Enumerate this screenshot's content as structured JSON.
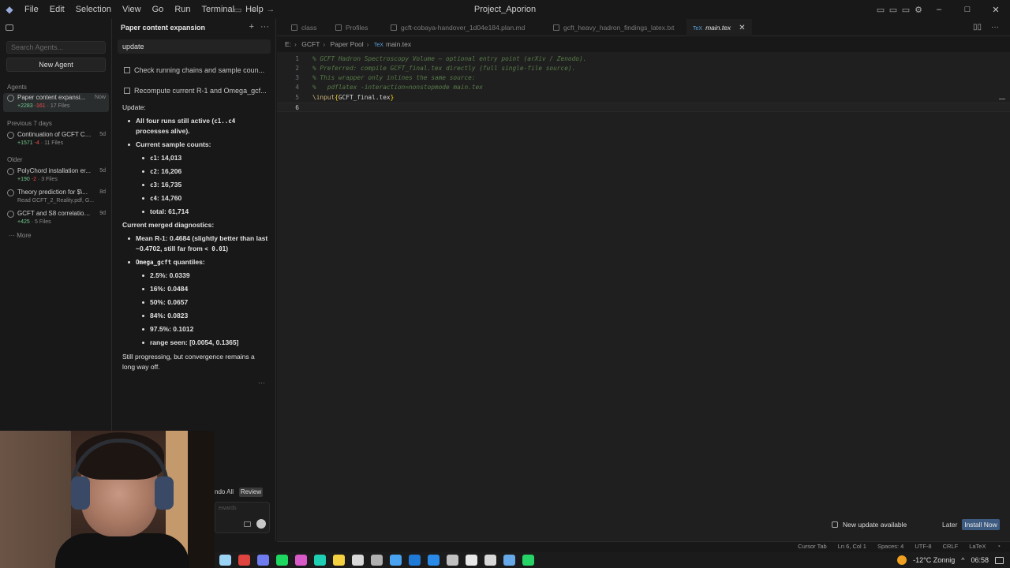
{
  "window": {
    "title": "Project_Aporion",
    "menu": [
      "File",
      "Edit",
      "Selection",
      "View",
      "Go",
      "Run",
      "Terminal",
      "Help"
    ]
  },
  "agents_panel": {
    "search_placeholder": "Search Agents...",
    "new_agent_label": "New Agent",
    "section_agents": "Agents",
    "section_prev7": "Previous 7 days",
    "section_older": "Older",
    "more_label": "More",
    "items": [
      {
        "name": "Paper content expansi...",
        "time": "Now",
        "plus": "+2283",
        "minus": "-161",
        "files": "· 17 Files",
        "active": true
      },
      {
        "name": "Continuation of GCFT Co...",
        "time": "5d",
        "plus": "+1571",
        "minus": "-4",
        "files": "· 11 Files"
      },
      {
        "name": "PolyChord installation er...",
        "time": "5d",
        "plus": "+190",
        "minus": "-2",
        "files": "· 3 Files"
      },
      {
        "name": "Theory prediction for $\\...",
        "time": "8d",
        "sub": "Read GCFT_2_Reality.pdf, G..."
      },
      {
        "name": "GCFT and S8 correlation ...",
        "time": "9d",
        "plus": "+425",
        "minus": "",
        "files": "· 5 Files"
      }
    ]
  },
  "chat": {
    "header": "Paper content expansion",
    "input_text": "update",
    "todos": [
      "Check running chains and sample coun...",
      "Recompute current R-1 and Omega_gcf..."
    ],
    "update_heading": "Update:",
    "runs_line_a": "All four runs still active (",
    "runs_code": "c1..c4",
    "runs_line_b": "processes alive).",
    "counts_heading": "Current sample counts:",
    "counts": [
      {
        "code": "c1",
        "value": ": 14,013"
      },
      {
        "code": "c2",
        "value": ": 16,206"
      },
      {
        "code": "c3",
        "value": ": 16,735"
      },
      {
        "code": "c4",
        "value": ": 14,760"
      }
    ],
    "total": "total: 61,714",
    "diag_heading": "Current merged diagnostics:",
    "mean_a": "Mean R-1: 0.4684",
    "mean_b": "(slightly better than last",
    "mean_c": "~0.4702, still far from",
    "mean_code": "< 0.01",
    "mean_d": ")",
    "omega_code": "Omega_gcft",
    "omega_label": "quantiles:",
    "quantiles": [
      "2.5%: 0.0339",
      "16%: 0.0484",
      "50%: 0.0657",
      "84%: 0.0823",
      "97.5%: 0.1012",
      "range seen: [0.0054, 0.1365]"
    ],
    "closing_a": "Still progressing, but convergence remains a",
    "closing_b": "long way off.",
    "undo_all": "ndo All",
    "review": "Review",
    "compose_placeholder": "ewards"
  },
  "editor": {
    "tabs": [
      {
        "label": "class"
      },
      {
        "label": "Profiles"
      },
      {
        "label": "gcft-cobaya-handover_1d04e184.plan.md"
      },
      {
        "label": "gcft_heavy_hadron_findings_latex.txt"
      },
      {
        "label": "main.tex",
        "active": true
      }
    ],
    "breadcrumb": [
      "E:",
      "GCFT",
      "Paper Pool",
      "main.tex"
    ],
    "lines": [
      {
        "n": "1",
        "text": "% GCFT Hadron Spectroscopy Volume — optional entry point (arXiv / Zenodo)."
      },
      {
        "n": "2",
        "text": "% Preferred: compile GCFT_final.tex directly (full single-file source)."
      },
      {
        "n": "3",
        "text": "% This wrapper only inlines the same source:"
      },
      {
        "n": "4",
        "text": "%   pdflatex -interaction=nonstopmode main.tex"
      },
      {
        "n": "5",
        "cmd": "\\input",
        "arg": "GCFT_final.tex"
      },
      {
        "n": "6",
        "text": ""
      }
    ]
  },
  "notification": {
    "message": "New update available",
    "later": "Later",
    "install": "Install Now"
  },
  "statusbar": {
    "items": [
      "Cursor Tab",
      "Ln 6, Col 1",
      "Spaces: 4",
      "UTF-8",
      "CRLF",
      "LaTeX"
    ]
  },
  "taskbar": {
    "weather": "-12°C  Zonnig",
    "time": "06:58",
    "icon_colors": [
      "#9bd3f5",
      "#e0443e",
      "#6f7cf0",
      "#1ed760",
      "#d85ac8",
      "#1fcfb4",
      "#f5d142",
      "#d8d8d8",
      "#b0b0b0",
      "#4aa3f0",
      "#1e7ad6",
      "#2a8ae8",
      "#c0c0c0",
      "#e8e8e8",
      "#d8d8d8",
      "#66a8e8",
      "#25d366"
    ]
  }
}
